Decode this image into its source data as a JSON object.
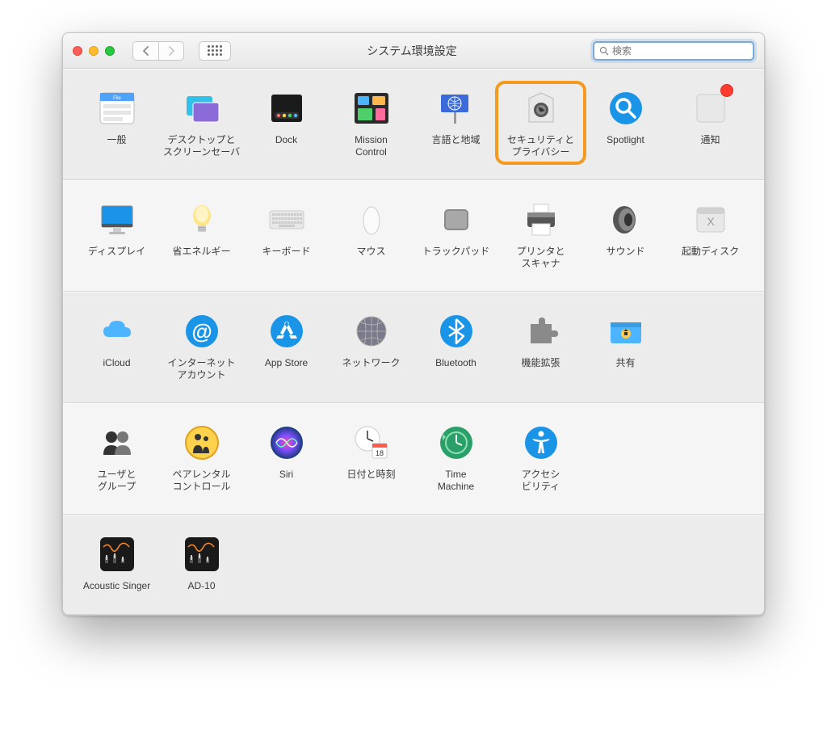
{
  "window": {
    "title": "システム環境設定"
  },
  "search": {
    "placeholder": "検索"
  },
  "rows": [
    {
      "alt": false,
      "items": [
        {
          "key": "general",
          "label": "一般"
        },
        {
          "key": "desktop",
          "label": "デスクトップと\nスクリーンセーバ"
        },
        {
          "key": "dock",
          "label": "Dock"
        },
        {
          "key": "mission",
          "label": "Mission\nControl"
        },
        {
          "key": "language",
          "label": "言語と地域"
        },
        {
          "key": "security",
          "label": "セキュリティと\nプライバシー",
          "highlight": true
        },
        {
          "key": "spotlight",
          "label": "Spotlight"
        },
        {
          "key": "notifications",
          "label": "通知",
          "badge": true
        }
      ]
    },
    {
      "alt": true,
      "items": [
        {
          "key": "displays",
          "label": "ディスプレイ"
        },
        {
          "key": "energy",
          "label": "省エネルギー"
        },
        {
          "key": "keyboard",
          "label": "キーボード"
        },
        {
          "key": "mouse",
          "label": "マウス"
        },
        {
          "key": "trackpad",
          "label": "トラックパッド"
        },
        {
          "key": "printers",
          "label": "プリンタと\nスキャナ"
        },
        {
          "key": "sound",
          "label": "サウンド"
        },
        {
          "key": "startup",
          "label": "起動ディスク"
        }
      ]
    },
    {
      "alt": false,
      "items": [
        {
          "key": "icloud",
          "label": "iCloud"
        },
        {
          "key": "internet",
          "label": "インターネット\nアカウント"
        },
        {
          "key": "appstore",
          "label": "App Store"
        },
        {
          "key": "network",
          "label": "ネットワーク"
        },
        {
          "key": "bluetooth",
          "label": "Bluetooth"
        },
        {
          "key": "extensions",
          "label": "機能拡張"
        },
        {
          "key": "sharing",
          "label": "共有"
        }
      ]
    },
    {
      "alt": true,
      "items": [
        {
          "key": "users",
          "label": "ユーザと\nグループ"
        },
        {
          "key": "parental",
          "label": "ペアレンタル\nコントロール"
        },
        {
          "key": "siri",
          "label": "Siri"
        },
        {
          "key": "datetime",
          "label": "日付と時刻",
          "day": "18"
        },
        {
          "key": "timemachine",
          "label": "Time\nMachine"
        },
        {
          "key": "accessibility",
          "label": "アクセシ\nビリティ"
        }
      ]
    },
    {
      "alt": false,
      "items": [
        {
          "key": "acoustic",
          "label": "Acoustic Singer"
        },
        {
          "key": "ad10",
          "label": "AD-10"
        }
      ]
    }
  ]
}
